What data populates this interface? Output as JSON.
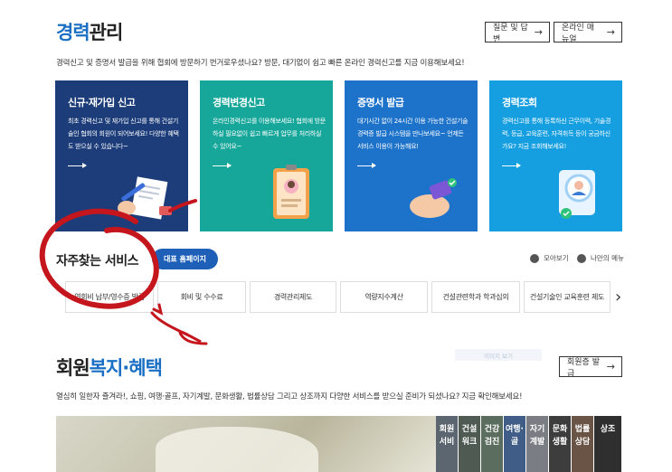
{
  "header": {
    "title_accent": "경력",
    "title_rest": "관리",
    "qa_button": "질문 및 답변",
    "manual_button": "온라인 매뉴얼",
    "description": "경력신고 및 증명서 발급을 위해 협회에 방문하기 번거로우셨나요? 방문, 대기없이 쉽고 빠른 온라인 경력신고를 지금 이용해보세요!"
  },
  "cards": [
    {
      "title": "신규·재가입 신고",
      "text": "최초 경력신고 및 재가입 신고를 통해 건설기술인 협회의 회원이 되어보세요! 다양한 혜택도 받으실 수 있습니다~",
      "color": "#1c3d7a"
    },
    {
      "title": "경력변경신고",
      "text": "온라인경력신고를 이용해보세요! 협회에 방문하실 필요없이 쉽고 빠르게 업무를 처리하실 수 있어요~",
      "color": "#17a79a"
    },
    {
      "title": "증명서 발급",
      "text": "대기시간 없이 24시간 이용 가능한 건설기술경력증 발급 시스템을 만나보세요~ 언제든 서비스 이용이 가능해요!",
      "color": "#1d72c9"
    },
    {
      "title": "경력조회",
      "text": "경력신고를 통해 등록하신 근무이력, 기술경력, 등급, 교육훈련, 자격취득 등이 궁금하신가요? 지금 조회해보세요!",
      "color": "#159ee0"
    }
  ],
  "services": {
    "title": "자주찾는 서비스",
    "pill": "대표 홈페이지",
    "view_all": "모아보기",
    "my_menu": "나만의 메뉴",
    "items": [
      "연회비 납부/영수증 발급",
      "회비 및 수수료",
      "경력관리제도",
      "역량지수계산",
      "건설관련학과 학과심의",
      "건설기술인 교육훈련 제도"
    ]
  },
  "welfare": {
    "title_accent_1": "회원",
    "title_accent_2": "복지·혜택",
    "member_card_button": "회원증 발급",
    "description": "열심히 일한자 즐겨라!, 쇼핑, 여행·골프, 자기계발, 문화생활, 법률상담 그리고 상조까지 다양한 서비스를 받으실 준비가 되셨나요? 지금 확인해보세요!",
    "faint_label": "이미지 보기",
    "tabs": [
      {
        "label": "회원서비",
        "color": "#5c6670"
      },
      {
        "label": "건설워크",
        "color": "#4f5a52"
      },
      {
        "label": "건강검진",
        "color": "#5b6d5e"
      },
      {
        "label": "여행·골",
        "color": "#3f5d86"
      },
      {
        "label": "자기계발",
        "color": "#7a7d83"
      },
      {
        "label": "문화생활",
        "color": "#3d3d3d"
      },
      {
        "label": "법률상담",
        "color": "#6a5446"
      },
      {
        "label": "상조",
        "color": "#2f2f2f"
      }
    ]
  }
}
